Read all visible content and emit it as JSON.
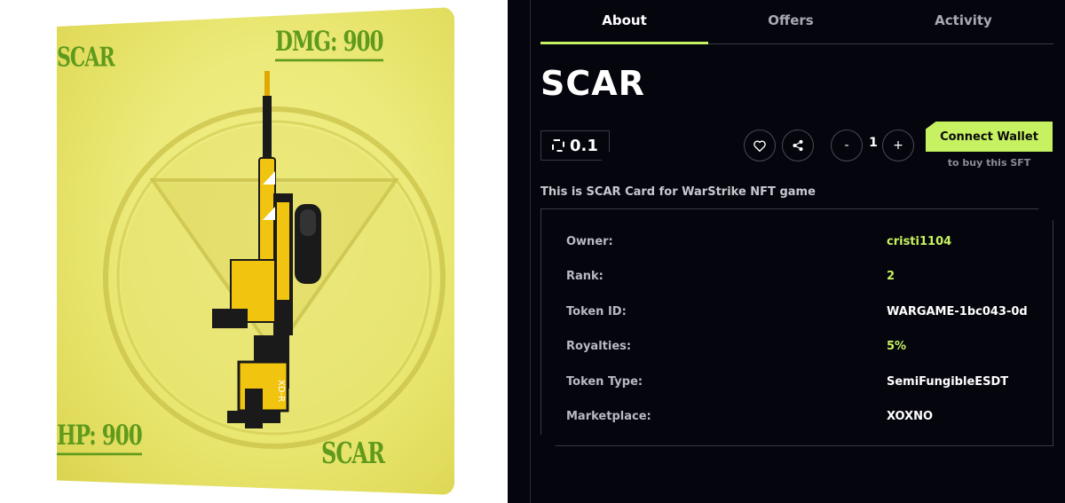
{
  "card": {
    "top_left": "SCAR",
    "top_right": "DMG: 900",
    "bottom_left": "HP: 900",
    "bottom_right": "SCAR",
    "accent_color": "#5f9a1c",
    "background_color": "#ecea7a",
    "weapon_colors": [
      "#f1c40f",
      "#1a1a1a",
      "#ffffff"
    ]
  },
  "tabs": [
    {
      "label": "About",
      "active": true
    },
    {
      "label": "Offers",
      "active": false
    },
    {
      "label": "Activity",
      "active": false
    }
  ],
  "title": "SCAR",
  "price": {
    "value": "0.1",
    "icon": "egld-icon"
  },
  "actions": {
    "like_icon": "heart-icon",
    "share_icon": "share-icon",
    "minus": "-",
    "quantity": "1",
    "plus": "+"
  },
  "connect": {
    "label": "Connect Wallet",
    "hint": "to buy this SFT",
    "color": "#c6f161"
  },
  "description": "This is SCAR Card for WarStrike NFT game",
  "details": [
    {
      "label": "Owner:",
      "value": "cristi1104",
      "accent": true
    },
    {
      "label": "Rank:",
      "value": "2",
      "accent": true
    },
    {
      "label": "Token ID:",
      "value": "WARGAME-1bc043-0d",
      "accent": false
    },
    {
      "label": "Royalties:",
      "value": "5%",
      "accent": true
    },
    {
      "label": "Token Type:",
      "value": "SemiFungibleESDT",
      "accent": false
    },
    {
      "label": "Marketplace:",
      "value": "XOXNO",
      "accent": false
    }
  ]
}
